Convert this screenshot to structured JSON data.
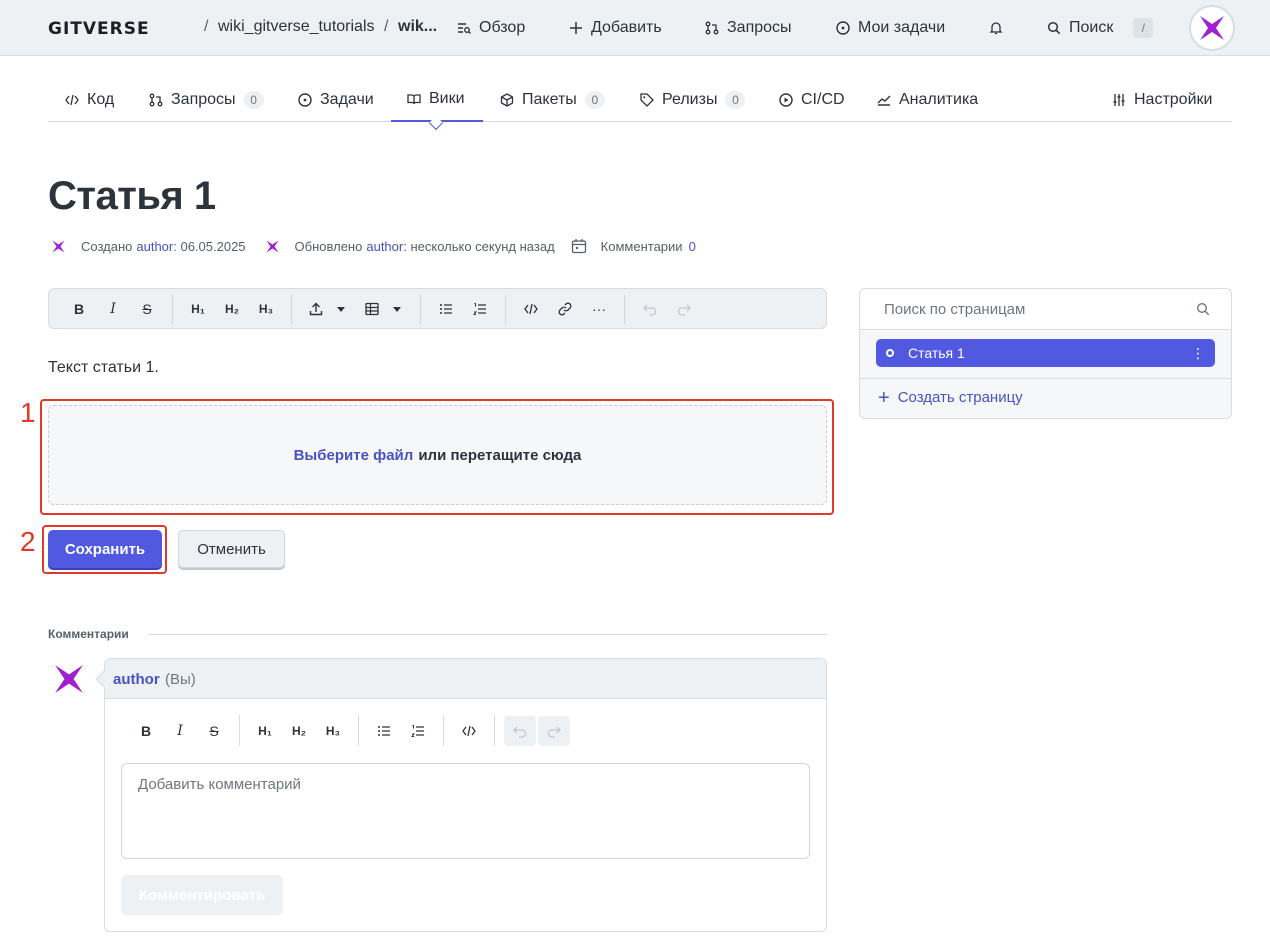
{
  "header": {
    "logo": "GITVERSE",
    "breadcrumb": {
      "sep1": "/",
      "repo": "wiki_gitverse_tutorials",
      "sep2": "/",
      "page": "wik..."
    },
    "nav": {
      "overview": "Обзор",
      "add": "Добавить",
      "requests": "Запросы",
      "tasks": "Мои задачи",
      "search": "Поиск",
      "search_kbd": "/"
    }
  },
  "tabs": [
    {
      "label": "Код"
    },
    {
      "label": "Запросы",
      "count": "0"
    },
    {
      "label": "Задачи"
    },
    {
      "label": "Вики",
      "active": true
    },
    {
      "label": "Пакеты",
      "count": "0"
    },
    {
      "label": "Релизы",
      "count": "0"
    },
    {
      "label": "CI/CD"
    },
    {
      "label": "Аналитика"
    },
    {
      "label": "Настройки"
    }
  ],
  "page": {
    "title": "Статья 1",
    "meta": {
      "created_label": "Создано",
      "created_author": "author",
      "created_date": ": 06.05.2025",
      "updated_label": "Обновлено",
      "updated_author": "author",
      "updated_time": ": несколько секунд назад",
      "comments_label": "Комментарии",
      "comments_count": "0"
    },
    "body_text": "Текст статьи 1."
  },
  "editor_toolbar": {
    "bold": "B",
    "italic": "I",
    "strike": "S",
    "h1": "H₁",
    "h2": "H₂",
    "h3": "H₃",
    "more": "···"
  },
  "dropzone": {
    "link": "Выберите файл",
    "text": "или перетащите сюда"
  },
  "steps": {
    "one": "1",
    "two": "2"
  },
  "actions": {
    "save": "Сохранить",
    "cancel": "Отменить"
  },
  "sidebar": {
    "search_placeholder": "Поиск по страницам",
    "items": [
      {
        "label": "Статья 1",
        "more": "⋮"
      }
    ],
    "create": "Создать страницу",
    "create_icon": "+"
  },
  "comments": {
    "heading": "Комментарии",
    "author": "author",
    "you": "(Вы)",
    "input_placeholder": "Добавить комментарий",
    "submit": "Комментировать"
  },
  "colors": {
    "accent": "#5059e0",
    "link": "#4752c4",
    "highlight": "#e0392b",
    "avatar": "#a020d0"
  }
}
